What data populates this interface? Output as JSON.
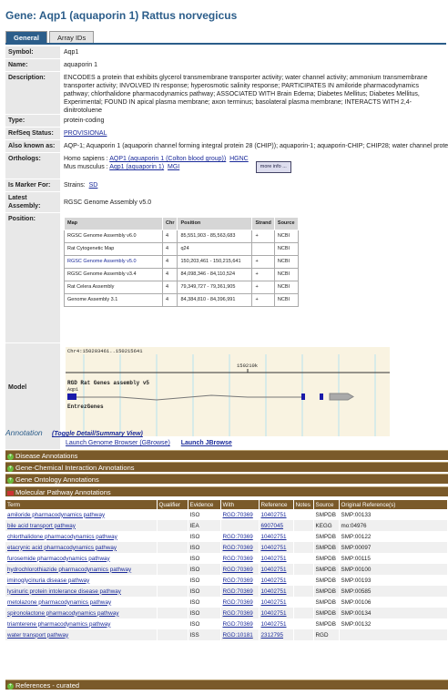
{
  "title": "Gene: Aqp1 (aquaporin 1) Rattus norvegicus",
  "tabs": [
    "General",
    "Array IDs"
  ],
  "symbol": {
    "label": "Symbol:",
    "value": "Aqp1"
  },
  "name": {
    "label": "Name:",
    "value": "aquaporin 1"
  },
  "description": {
    "label": "Description:",
    "value": "ENCODES a protein that exhibits glycerol transmembrane transporter activity; water channel activity; ammonium transmembrane transporter activity; INVOLVED IN response; hyperosmotic salinity response; PARTICIPATES IN amiloride pharmacodynamics pathway; chlorthalidone pharmacodynamics pathway; ASSOCIATED WITH Brain Edema; Diabetes Mellitus; Diabetes Mellitus, Experimental; FOUND IN apical plasma membrane; axon terminus; basolateral plasma membrane; INTERACTS WITH 2,4-dinitrotoluene"
  },
  "type": {
    "label": "Type:",
    "value": "protein-coding"
  },
  "refseq": {
    "label": "RefSeq Status:",
    "value": "PROVISIONAL"
  },
  "aka": {
    "label": "Also known as:",
    "value": "AQP-1; Aquaporin 1 (aquaporin channel forming integral protein 28 (CHIP)); aquaporin-1; aquaporin-CHIP; CHIP28; water channel protein"
  },
  "orthologs": {
    "label": "Orthologs:",
    "human_prefix": "Homo sapiens :",
    "human_link": "AQP1 (aquaporin 1 (Colton blood group))",
    "human_db": "HGNC",
    "mouse_prefix": "Mus musculus :",
    "mouse_link": "Aqp1 (aquaporin 1)",
    "mouse_db": "MGI",
    "more": "more info ..."
  },
  "marker": {
    "label": "Is Marker For:",
    "strains_label": "Strains:",
    "strains_value": "SD"
  },
  "assembly": {
    "label": "Latest Assembly:",
    "value": "RGSC Genome Assembly v5.0"
  },
  "position": {
    "label": "Position:",
    "headers": [
      "Map",
      "Chr",
      "Position",
      "Strand",
      "Source"
    ],
    "rows": [
      [
        "RGSC Genome Assembly v6.0",
        "4",
        "85,551,903 - 85,563,683",
        "+",
        "NCBI"
      ],
      [
        "Rat Cytogenetic Map",
        "4",
        "q24",
        "",
        "NCBI"
      ],
      [
        "RGSC Genome Assembly v5.0",
        "4",
        "150,203,461 - 150,215,641",
        "+",
        "NCBI"
      ],
      [
        "RGSC Genome Assembly v3.4",
        "4",
        "84,098,346 - 84,110,524",
        "+",
        "NCBI"
      ],
      [
        "Rat Celera Assembly",
        "4",
        "79,349,727 - 79,361,905",
        "+",
        "NCBI"
      ],
      [
        "Genome Assembly 3.1",
        "4",
        "84,384,810 - 84,396,991",
        "+",
        "NCBI"
      ]
    ]
  },
  "model": {
    "label": "Model",
    "coords": "Chr4:150203461..150215641",
    "scale": "150210k",
    "track": "RGD Rat Genes assembly v5",
    "gene": "Aqp1",
    "track2": "EntrezGenes",
    "link_gbrowse": "Launch Genome Browser (GBrowse)",
    "link_jbrowse": "Launch JBrowse"
  },
  "annotation": {
    "title": "Annotation",
    "toggle": "(Toggle Detail/Summary View)"
  },
  "sections": {
    "disease": "Disease Annotations",
    "chem": "Gene-Chemical Interaction Annotations",
    "go": "Gene Ontology Annotations",
    "mp": "Molecular Pathway Annotations",
    "refs": "References - curated"
  },
  "mp_table": {
    "headers": [
      "Term",
      "Qualifier",
      "Evidence",
      "With",
      "Reference",
      "Notes",
      "Source",
      "Original Reference(s)"
    ],
    "rows": [
      [
        "amiloride pharmacodynamics pathway",
        "",
        "ISO",
        "RGD:70369",
        "10402751",
        "",
        "SMPDB",
        "SMP:00133"
      ],
      [
        "bile acid transport pathway",
        "",
        "IEA",
        "",
        "6907045",
        "",
        "KEGG",
        "mo:04976"
      ],
      [
        "chlorthalidone pharmacodynamics pathway",
        "",
        "ISO",
        "RGD:70369",
        "10402751",
        "",
        "SMPDB",
        "SMP:00122"
      ],
      [
        "etacrynic acid pharmacodynamics pathway",
        "",
        "ISO",
        "RGD:70369",
        "10402751",
        "",
        "SMPDB",
        "SMP:00097"
      ],
      [
        "furosemide pharmacodynamics pathway",
        "",
        "ISO",
        "RGD:70369",
        "10402751",
        "",
        "SMPDB",
        "SMP:00115"
      ],
      [
        "hydrochlorothiazide pharmacodynamics pathway",
        "",
        "ISO",
        "RGD:70369",
        "10402751",
        "",
        "SMPDB",
        "SMP:00100"
      ],
      [
        "iminoglycinuria disease pathway",
        "",
        "ISO",
        "RGD:70369",
        "10402751",
        "",
        "SMPDB",
        "SMP:00193"
      ],
      [
        "lysinuric protein intolerance disease pathway",
        "",
        "ISO",
        "RGD:70369",
        "10402751",
        "",
        "SMPDB",
        "SMP:00585"
      ],
      [
        "metolazone pharmacodynamics pathway",
        "",
        "ISO",
        "RGD:70369",
        "10402751",
        "",
        "SMPDB",
        "SMP:00106"
      ],
      [
        "spironolactone pharmacodynamics pathway",
        "",
        "ISO",
        "RGD:70369",
        "10402751",
        "",
        "SMPDB",
        "SMP:00134"
      ],
      [
        "triamterene pharmacodynamics pathway",
        "",
        "ISO",
        "RGD:70369",
        "10402751",
        "",
        "SMPDB",
        "SMP:00132"
      ],
      [
        "water transport pathway",
        "",
        "ISS",
        "RGD:10181",
        "2312795",
        "",
        "RGD",
        ""
      ]
    ]
  }
}
